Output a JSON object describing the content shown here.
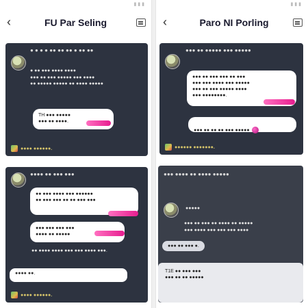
{
  "left": {
    "status": "",
    "title": "FU Par Seling",
    "card1": {
      "head": "● ● ● ● ●● ●● ●● ● ●● ●●",
      "body": "● ●● ●●● ●●●● ●●●●\n●●● ●● ●●● ●●●●● ●●● ●●●●\n●● ●●●●● ●●●●● ●● ●●●● ●●●●●",
      "reply": "TH ●●● ●●●●●\n●●● ●● ●●●●.",
      "footer": "●●●● ●●●●●●."
    },
    "card2": {
      "head": "●●●● ●● ●●● ●●●",
      "bubble1": "●● ●●● ●●●● ●●● ●●●●●●\n●● ●●● ●●● ●● ●● ●●● ●●●",
      "bubble2": "●●● ●●● ●●● ●●●\n●●●● ●● ●●●●●",
      "line": "●● ●●●● ●●●● ●●● ●●● ●●●● ●●●.",
      "composer": "●●●● ●●.",
      "footer": "●●●● ●●●●●●."
    }
  },
  "right": {
    "status": "",
    "title": "Paro NI Porling",
    "card1": {
      "head": "●●● ●● ●●●●● ●●● ●●●●●",
      "bubble": "●●● ●● ●●● ●●● ●● ●●●\n●●● ●●● ●●●● ●●● ●●●●●\n●●● ●● ●●● ●●●●● ●●●●\n●●● ●●●●●●●●.",
      "reply": "●●● ●● ●● ●● ●●● ●●●●●",
      "footer": "●●●●●● ●●●●●●●."
    },
    "card2": {
      "head": "●●● ●●●● ●● ●●●● ●●●●●",
      "subhead": "●●●●●",
      "body": "●●● ●● ●●● ●● ●●●● ●● ●●●●●\n●●● ●●●● ●●● ●●● ●●● ●●●●",
      "chip": "●●● ●● ●●● ●."
    },
    "card3": {
      "text": "T1E ●● ●●● ●●●\n●●● ●● ●● ●●●●●"
    }
  },
  "colors": {
    "accent": "#e71e8f",
    "card": "#2d3340",
    "background": "#ffffff"
  },
  "icons": [
    "back-arrow-icon",
    "menu-icon",
    "avatar",
    "reaction-emoji-icon",
    "footer-badge-icon"
  ]
}
